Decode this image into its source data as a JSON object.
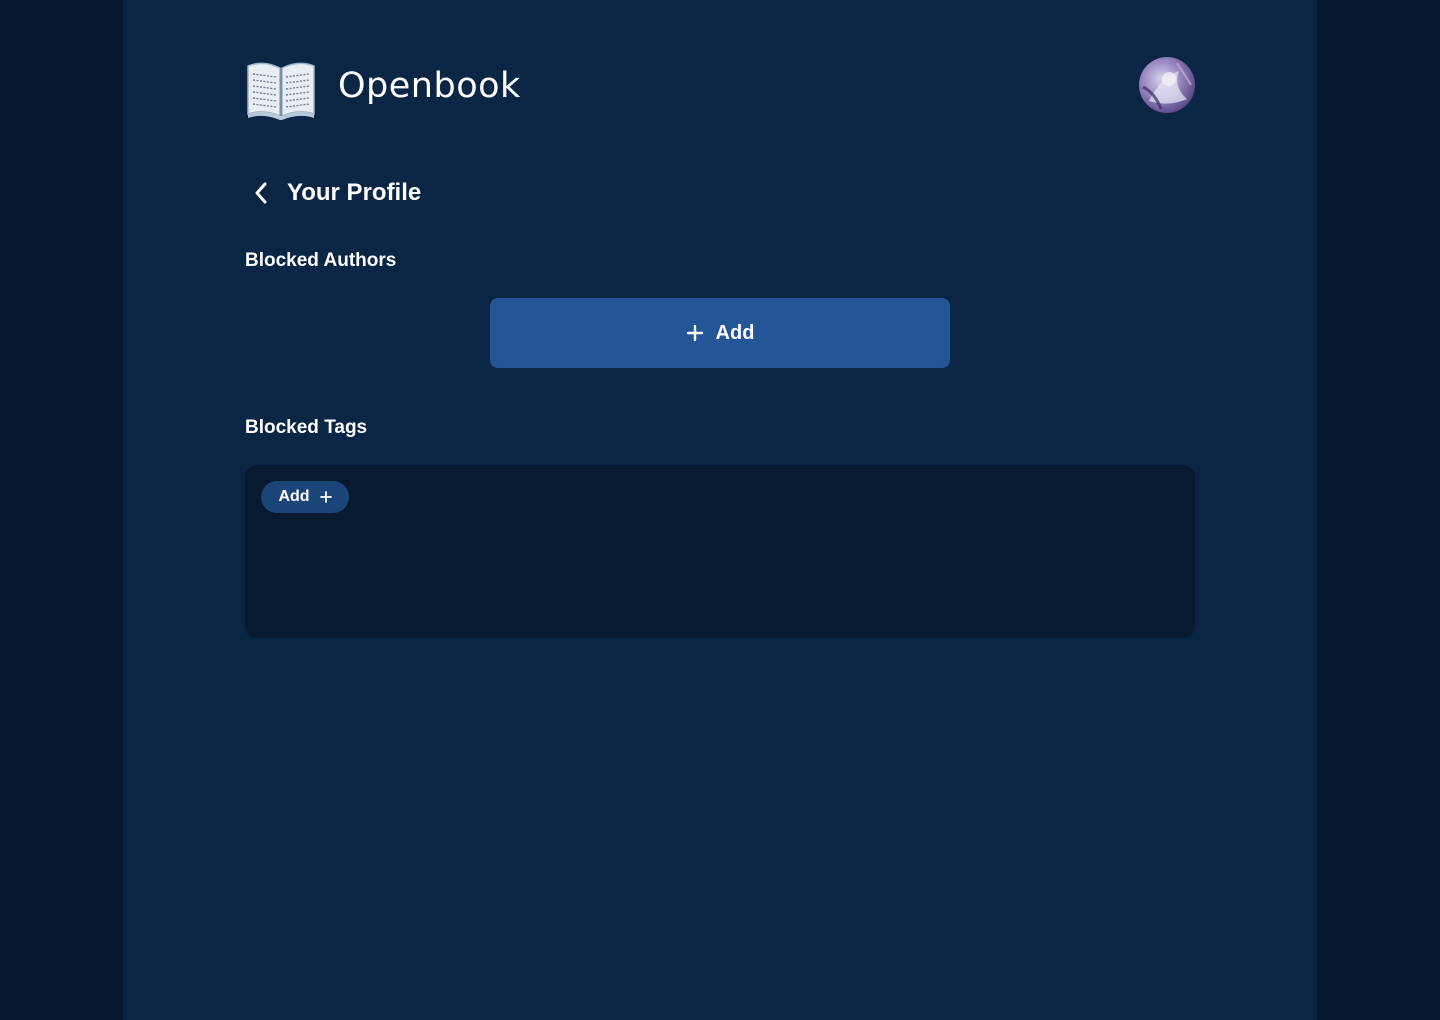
{
  "app": {
    "brand_name": "Openbook",
    "logo_icon": "open-book-icon",
    "avatar_icon": "user-avatar"
  },
  "header": {
    "back_icon": "chevron-left-icon",
    "title": "Your Profile"
  },
  "blocked_authors": {
    "title": "Blocked Authors",
    "add_label": "Add",
    "add_icon": "plus-icon"
  },
  "blocked_tags": {
    "title": "Blocked Tags",
    "add_label": "Add",
    "add_icon": "plus-icon"
  },
  "colors": {
    "background_outer": "#08182d",
    "background_page": "#0b2545",
    "primary_button": "#235597",
    "tag_box": "#081a30",
    "tag_button": "#1b4478",
    "text": "#ffffff"
  }
}
